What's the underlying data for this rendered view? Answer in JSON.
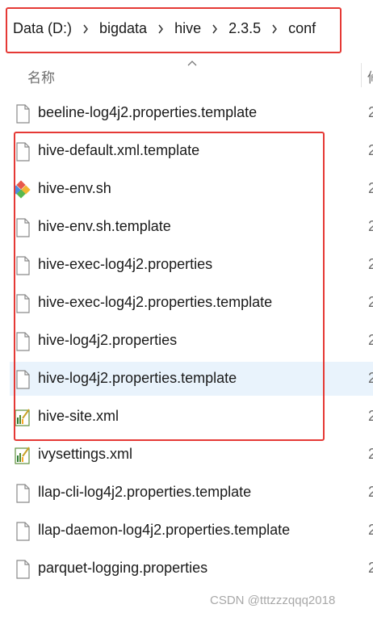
{
  "breadcrumb": [
    "Data (D:)",
    "bigdata",
    "hive",
    "2.3.5",
    "conf"
  ],
  "column_header": {
    "name": "名称",
    "next_column_truncated": "修"
  },
  "files": [
    {
      "name": "beeline-log4j2.properties.template",
      "icon": "file-icon",
      "date": "2"
    },
    {
      "name": "hive-default.xml.template",
      "icon": "file-icon",
      "date": "2"
    },
    {
      "name": "hive-env.sh",
      "icon": "git-shell-icon",
      "date": "2"
    },
    {
      "name": "hive-env.sh.template",
      "icon": "file-icon",
      "date": "2"
    },
    {
      "name": "hive-exec-log4j2.properties",
      "icon": "file-icon",
      "date": "2"
    },
    {
      "name": "hive-exec-log4j2.properties.template",
      "icon": "file-icon",
      "date": "2"
    },
    {
      "name": "hive-log4j2.properties",
      "icon": "file-icon",
      "date": "2"
    },
    {
      "name": "hive-log4j2.properties.template",
      "icon": "file-icon",
      "date": "2",
      "selected": true
    },
    {
      "name": "hive-site.xml",
      "icon": "xml-file-icon",
      "date": "2"
    },
    {
      "name": "ivysettings.xml",
      "icon": "xml-file-icon",
      "date": "2"
    },
    {
      "name": "llap-cli-log4j2.properties.template",
      "icon": "file-icon",
      "date": "2"
    },
    {
      "name": "llap-daemon-log4j2.properties.template",
      "icon": "file-icon",
      "date": "2"
    },
    {
      "name": "parquet-logging.properties",
      "icon": "file-icon",
      "date": "2"
    }
  ],
  "watermark": "CSDN @tttzzzqqq2018",
  "colors": {
    "highlight_border": "#e53935",
    "selected_row": "#e9f3fc"
  }
}
